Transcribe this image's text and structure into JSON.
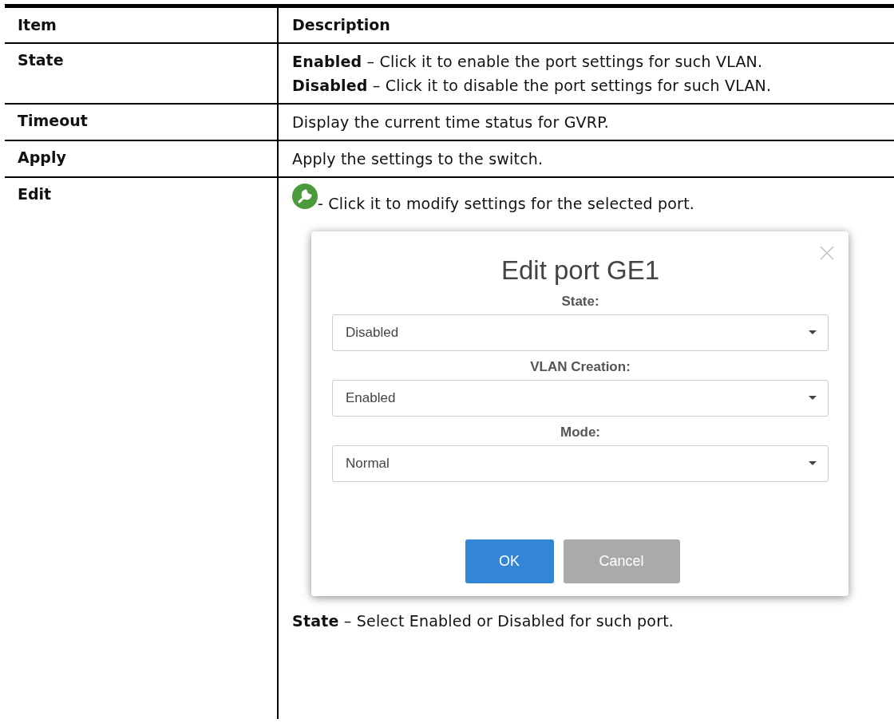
{
  "table": {
    "columns": [
      "Item",
      "Description"
    ],
    "rows": [
      {
        "item": "State",
        "blocks": [
          {
            "kind": "text",
            "text": "**Enabled** – Click it to enable the port settings for such VLAN."
          },
          {
            "kind": "text",
            "text": "**Disabled** – Click it to disable the port settings for such VLAN."
          }
        ]
      },
      {
        "item": "Timeout",
        "blocks": [
          {
            "kind": "text",
            "text": "Display the current time status for GVRP."
          }
        ]
      },
      {
        "item": "Apply",
        "blocks": [
          {
            "kind": "text",
            "text": "Apply the settings to the switch."
          }
        ]
      },
      {
        "item": "Edit",
        "blocks": [
          {
            "kind": "icon_text",
            "text": "- Click it to modify settings for the selected port."
          },
          {
            "kind": "dialog",
            "title": "Edit port GE1",
            "fields": [
              {
                "label": "State:",
                "value": "Disabled"
              },
              {
                "label": "VLAN Creation:",
                "value": "Enabled"
              },
              {
                "label": "Mode:",
                "value": "Normal"
              }
            ],
            "buttons": [
              {
                "label": "OK",
                "kind": "primary"
              },
              {
                "label": "Cancel",
                "kind": "secondary"
              }
            ]
          },
          {
            "kind": "text",
            "text": "**State** – Select Enabled or Disabled for such port."
          }
        ]
      }
    ]
  }
}
